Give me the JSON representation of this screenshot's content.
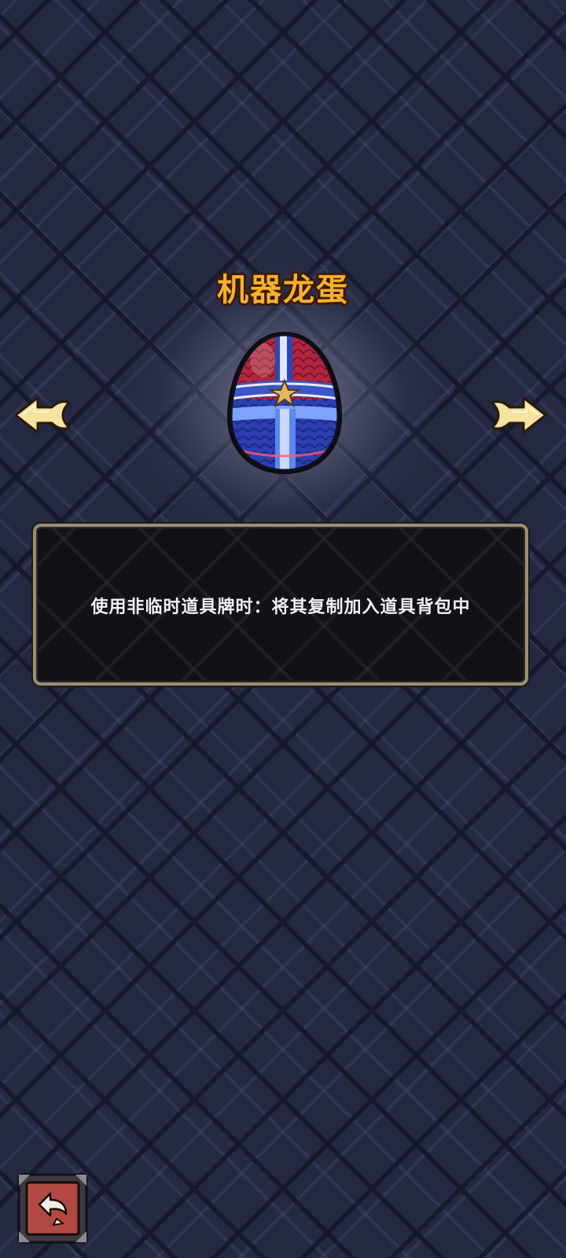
{
  "item": {
    "title": "机器龙蛋",
    "description": "使用非临时道具牌时：将其复制加入道具背包中",
    "image": "robot-dragon-egg-icon"
  },
  "navigation": {
    "prev_icon": "left-arrow-icon",
    "next_icon": "right-arrow-icon",
    "back_icon": "return-arrow-icon"
  },
  "colors": {
    "title": "#f6b12b",
    "panel_border": "#9c8f70",
    "background": "#252841",
    "back_button": "#b24a44"
  }
}
